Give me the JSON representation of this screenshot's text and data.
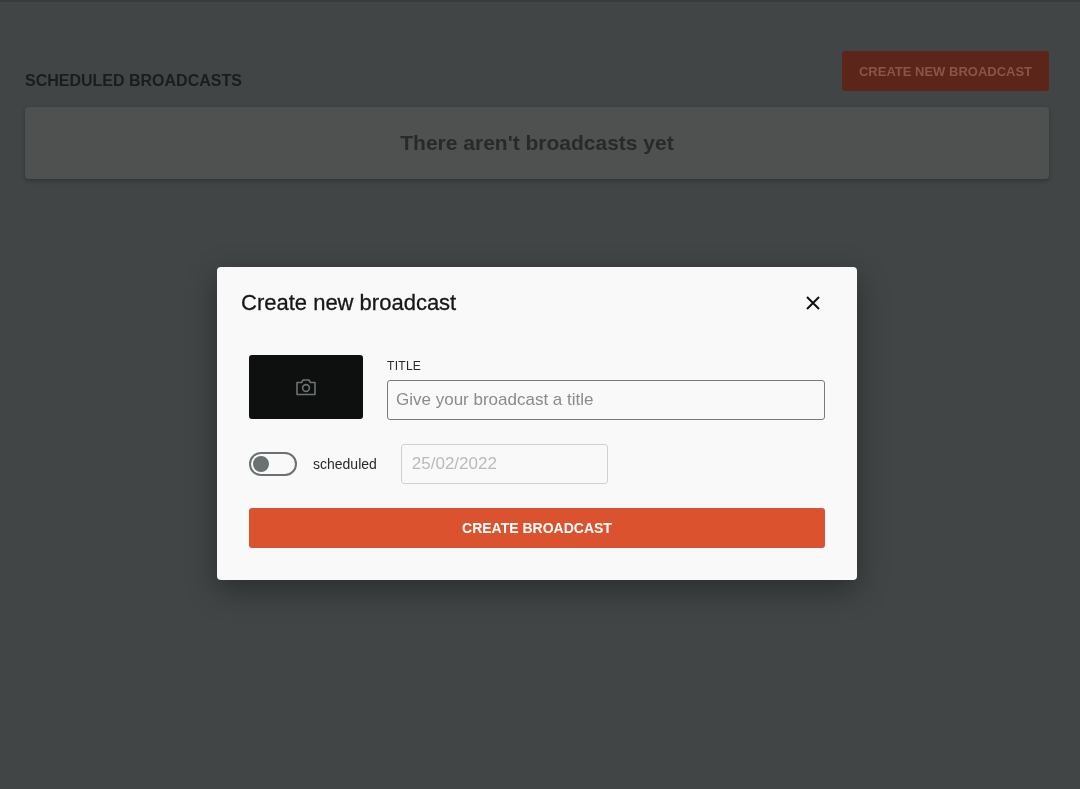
{
  "page": {
    "heading": "SCHEDULED BROADCASTS",
    "create_button": "CREATE NEW BROADCAST",
    "empty_message": "There aren't broadcasts yet"
  },
  "modal": {
    "title": "Create new broadcast",
    "title_label": "TITLE",
    "title_field": {
      "placeholder": "Give your broadcast a title"
    },
    "scheduled_toggle": {
      "label": "scheduled",
      "on": false
    },
    "date_field": {
      "value": "25/02/2022",
      "disabled": true
    },
    "submit_button": "CREATE BROADCAST"
  }
}
